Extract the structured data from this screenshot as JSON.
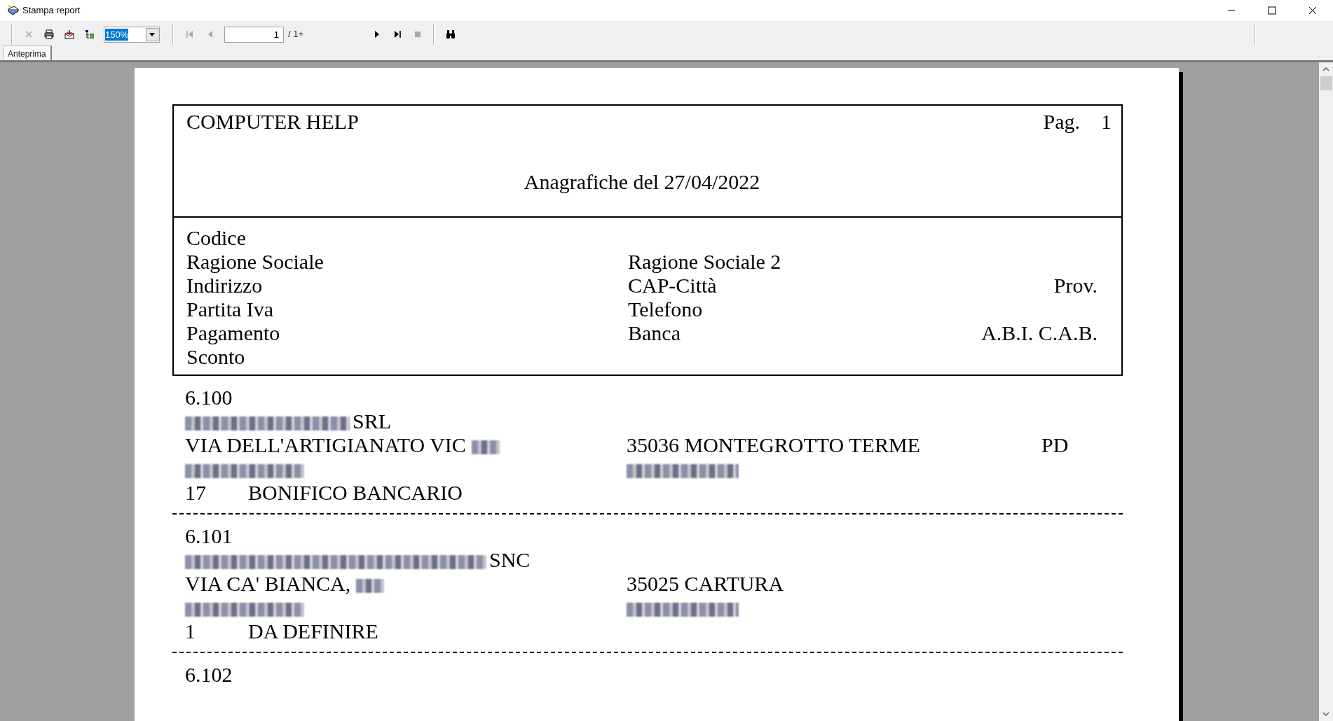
{
  "window": {
    "title": "Stampa report"
  },
  "toolbar": {
    "buttons": [
      {
        "kind": "close",
        "disabled": true
      },
      {
        "kind": "print",
        "disabled": false
      },
      {
        "kind": "export",
        "disabled": false
      },
      {
        "kind": "tree",
        "disabled": false
      }
    ],
    "zoom": "150%",
    "nav_buttons": [
      {
        "kind": "first",
        "disabled": true
      },
      {
        "kind": "prev",
        "disabled": true
      }
    ],
    "page": "1",
    "page_count": "/ 1+",
    "nav_buttons_after": [
      {
        "kind": "next",
        "disabled": false
      },
      {
        "kind": "last",
        "disabled": false
      },
      {
        "kind": "stop",
        "disabled": true
      }
    ],
    "search_button": {
      "kind": "find",
      "disabled": false
    }
  },
  "tabs": [
    {
      "label": "Anteprima",
      "selected": true
    }
  ],
  "report": {
    "company": "COMPUTER HELP",
    "page_label": "Pag.",
    "page_number": "1",
    "title": "Anagrafiche del 27/04/2022",
    "header_rows": [
      {
        "left": "Codice"
      },
      {
        "left": "Ragione Sociale",
        "middle": "Ragione Sociale 2"
      },
      {
        "left": "Indirizzo",
        "middle": "CAP-Città",
        "right": "Prov."
      },
      {
        "left": "Partita Iva",
        "middle": "Telefono"
      },
      {
        "left": "Pagamento",
        "middle": "Banca",
        "right": "A.B.I. C.A.B."
      },
      {
        "left": "Sconto"
      }
    ],
    "records": [
      {
        "code": "6.100",
        "name": "SRL",
        "address": "VIA DELL'ARTIGIANATO VIC",
        "city": "35036  MONTEGROTTO TERME",
        "province": "PD",
        "payment_code": "17",
        "payment": "BONIFICO BANCARIO"
      },
      {
        "code": "6.101",
        "name": "SNC",
        "address": "VIA CA' BIANCA,",
        "city": "35025  CARTURA",
        "payment_code": "1",
        "payment": "DA DEFINIRE"
      },
      {
        "code": "6.102"
      }
    ]
  }
}
